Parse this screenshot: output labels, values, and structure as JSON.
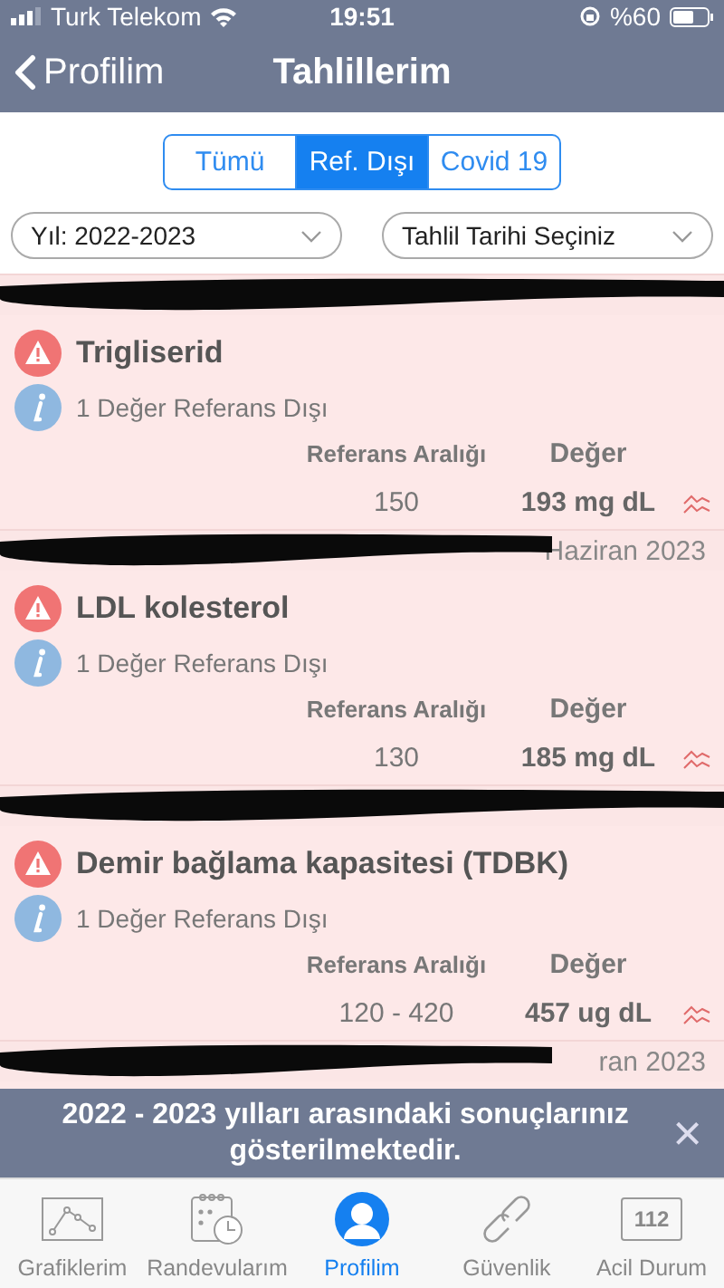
{
  "status_bar": {
    "carrier": "Turk Telekom",
    "time": "19:51",
    "battery": "%60"
  },
  "nav": {
    "back": "Profilim",
    "title": "Tahlillerim"
  },
  "segments": [
    {
      "label": "Tümü",
      "selected": false
    },
    {
      "label": "Ref. Dışı",
      "selected": true
    },
    {
      "label": "Covid 19",
      "selected": false
    }
  ],
  "filters": [
    {
      "value": "Yıl: 2022-2023"
    },
    {
      "value": "Tahlil Tarihi Seçiniz"
    }
  ],
  "list": [
    {
      "kind": "date"
    },
    {
      "kind": "result",
      "name": "Trigliserid",
      "note": "1 Değer Referans Dışı",
      "range_label": "Referans Aralığı",
      "value_label": "Değer",
      "range": "150",
      "value": "193 mg dL"
    },
    {
      "kind": "date",
      "date": "Haziran 2023"
    },
    {
      "kind": "result",
      "name": "LDL kolesterol",
      "note": "1 Değer Referans Dışı",
      "range_label": "Referans Aralığı",
      "value_label": "Değer",
      "range": "130",
      "value": "185 mg dL"
    },
    {
      "kind": "date"
    },
    {
      "kind": "result",
      "name": "Demir bağlama kapasitesi (TDBK)",
      "note": "1 Değer Referans Dışı",
      "range_label": "Referans Aralığı",
      "value_label": "Değer",
      "range": "120 - 420",
      "value": "457 ug dL"
    },
    {
      "kind": "date",
      "date": "ran 2023"
    }
  ],
  "toast": {
    "message": "2022 - 2023 yılları arasındaki sonuçlarınız gösterilmektedir.",
    "close": "×"
  },
  "tabs": [
    {
      "label": "Grafiklerim",
      "selected": false
    },
    {
      "label": "Randevularım",
      "selected": false
    },
    {
      "label": "Profilim",
      "selected": true
    },
    {
      "label": "Güvenlik",
      "selected": false
    },
    {
      "label": "Acil Durum",
      "badge": "112",
      "selected": false
    }
  ]
}
